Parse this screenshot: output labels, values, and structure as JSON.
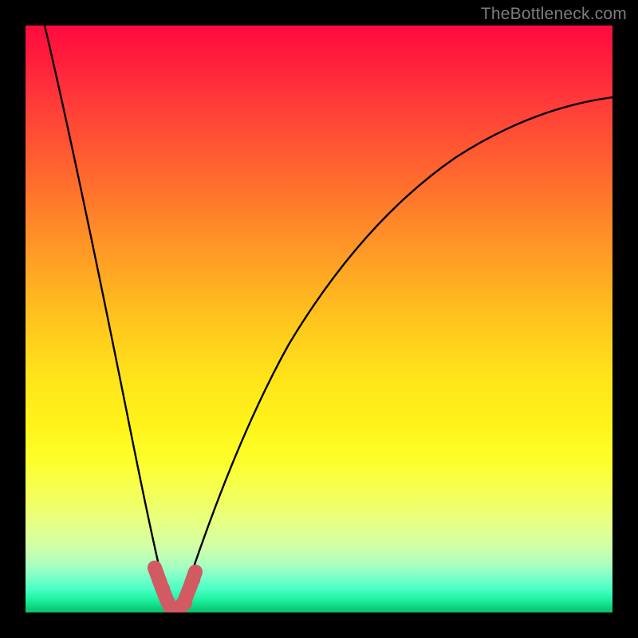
{
  "watermark": "TheBottleneck.com",
  "colors": {
    "frame_bg": "#000000",
    "curve": "#000000",
    "thick_curve": "#d15a63",
    "watermark": "#7d7d7d"
  },
  "chart_data": {
    "type": "line",
    "title": "",
    "xlabel": "",
    "ylabel": "",
    "xlim": [
      0,
      100
    ],
    "ylim": [
      0,
      100
    ],
    "grid": false,
    "legend": false,
    "note": "Values estimated from pixels: y is bottleneck %, x is normalized horizontal position. Curve bottoms out (~0%) near x≈25.",
    "series": [
      {
        "name": "left-branch",
        "x": [
          3.3,
          5,
          7,
          9,
          11,
          13,
          15,
          17,
          19,
          21,
          22,
          23,
          24,
          25
        ],
        "y": [
          100,
          92,
          82,
          72,
          62,
          52,
          42,
          33,
          23,
          13,
          8,
          4,
          1.5,
          0
        ]
      },
      {
        "name": "right-branch",
        "x": [
          25,
          26,
          27,
          28,
          29,
          30,
          32,
          34,
          36,
          38,
          40,
          44,
          48,
          52,
          56,
          60,
          64,
          68,
          72,
          76,
          80,
          84,
          88,
          92,
          96,
          100
        ],
        "y": [
          0,
          1.5,
          4,
          7,
          10,
          13,
          19,
          24.5,
          29.5,
          34,
          38,
          45,
          51,
          56,
          60.5,
          64.5,
          68,
          71,
          73.8,
          76.3,
          78.5,
          80.5,
          82.3,
          84,
          85.5,
          87
        ]
      },
      {
        "name": "highlighted-segment",
        "x": [
          22,
          23,
          24,
          25,
          26,
          27,
          28
        ],
        "y": [
          8,
          4,
          1.5,
          0,
          1.5,
          4,
          7
        ]
      }
    ]
  }
}
